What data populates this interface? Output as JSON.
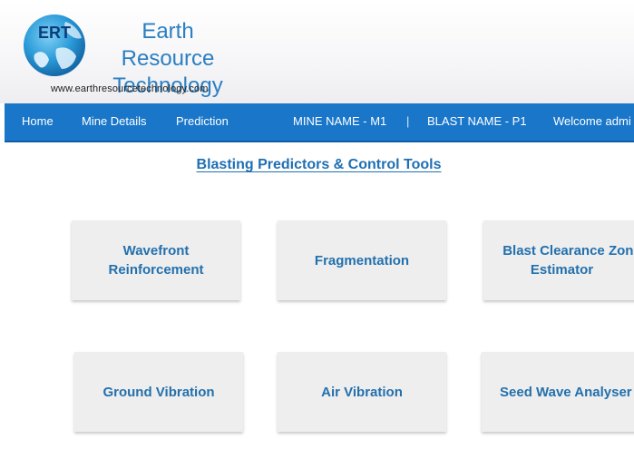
{
  "brand": {
    "logo_text": "ERT",
    "name_line1": "Earth Resource",
    "name_line2": "Technology",
    "website": "www.earthresourcetechnology.com"
  },
  "nav": {
    "home": "Home",
    "mine_details": "Mine Details",
    "prediction": "Prediction",
    "mine_name": "MINE NAME -  M1",
    "separator": "|",
    "blast_name": "BLAST NAME -  P1",
    "welcome": "Welcome admi"
  },
  "page": {
    "title": "Blasting Predictors & Control Tools"
  },
  "tools": [
    {
      "line1": "Wavefront",
      "line2": "Reinforcement"
    },
    {
      "line1": "Fragmentation"
    },
    {
      "line1": "Blast Clearance Zone",
      "line2": "Estimator"
    },
    {
      "line1": "Ground Vibration"
    },
    {
      "line1": "Air Vibration"
    },
    {
      "line1": "Seed Wave Analyser"
    }
  ],
  "colors": {
    "nav_bg": "#1976c9",
    "brand_blue": "#2b7fc1",
    "tile_bg": "#eeeeee",
    "tile_text": "#2370ad"
  }
}
